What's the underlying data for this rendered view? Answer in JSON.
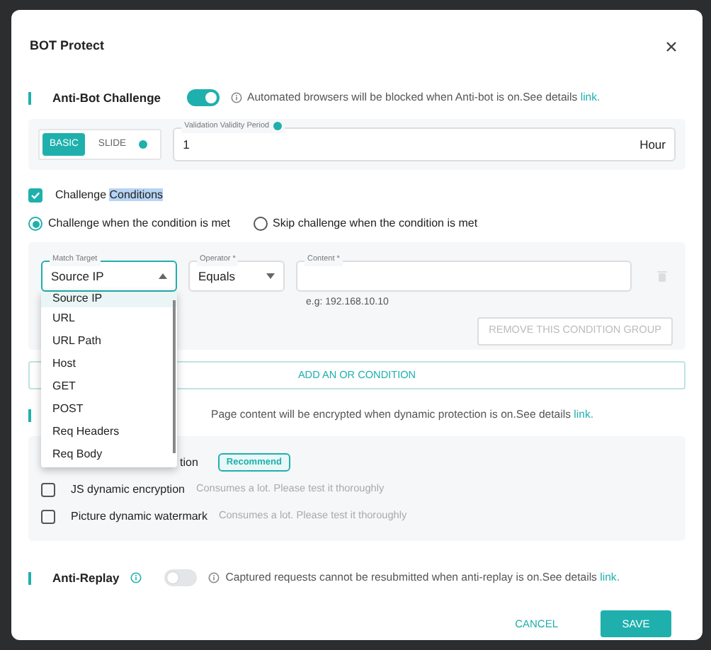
{
  "dialog": {
    "title": "BOT Protect"
  },
  "anti_bot": {
    "title": "Anti-Bot Challenge",
    "on": true,
    "info": "Automated browsers will be blocked when Anti-bot is on.See details ",
    "link": "link."
  },
  "modes": [
    {
      "label": "BASIC",
      "selected": true
    },
    {
      "label": "SLIDE",
      "selected": false
    }
  ],
  "validity": {
    "label": "Validation Validity Period",
    "value": "1",
    "unit": "Hour"
  },
  "challenge_conditions": {
    "label": "Challenge",
    "selected_text": "Conditions",
    "checked": true
  },
  "challenge_modes": [
    {
      "label": "Challenge when the condition is met",
      "selected": true
    },
    {
      "label": "Skip challenge when the condition is met",
      "selected": false
    }
  ],
  "condition": {
    "match_target": {
      "label": "Match Target",
      "value": "Source IP",
      "expanded": true
    },
    "operator": {
      "label": "Operator *",
      "value": "Equals"
    },
    "content": {
      "label": "Content *",
      "hint": "e.g: 192.168.10.10"
    },
    "remove_button": "REMOVE THIS CONDITION GROUP"
  },
  "add_or_button": "ADD AN OR CONDITION",
  "match_target_options": [
    {
      "label": "Source IP",
      "selected": true
    },
    {
      "label": "URL",
      "selected": false
    },
    {
      "label": "URL Path",
      "selected": false
    },
    {
      "label": "Host",
      "selected": false
    },
    {
      "label": "GET",
      "selected": false
    },
    {
      "label": "POST",
      "selected": false
    },
    {
      "label": "Req Headers",
      "selected": false
    },
    {
      "label": "Req Body",
      "selected": false
    }
  ],
  "dynamic": {
    "info": "Page content will be encrypted when dynamic protection is on.See details ",
    "link": "link.",
    "options": [
      {
        "label": "tion",
        "badge": "Recommend"
      },
      {
        "label": "JS dynamic encryption",
        "note": "Consumes a lot. Please test it thoroughly",
        "checked": false
      },
      {
        "label": "Picture dynamic watermark",
        "note": "Consumes a lot. Please test it thoroughly",
        "checked": false
      }
    ]
  },
  "anti_replay": {
    "title": "Anti-Replay",
    "on": false,
    "info": "Captured requests cannot be resubmitted when anti-replay is on.See details ",
    "link": "link."
  },
  "buttons": {
    "cancel": "CANCEL",
    "save": "SAVE"
  }
}
